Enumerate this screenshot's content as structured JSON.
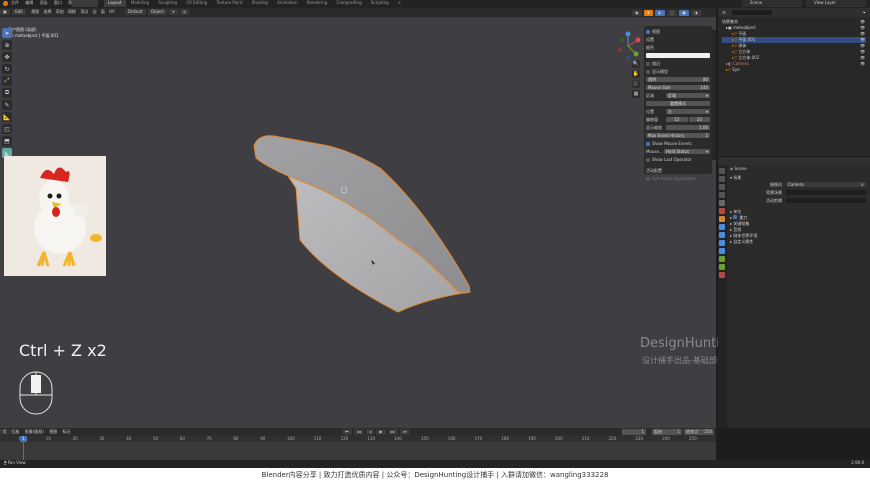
{
  "app": {
    "menu": [
      "文件",
      "编辑",
      "渲染",
      "窗口",
      "帮助"
    ],
    "workspace_tabs": [
      "Layout",
      "Modeling",
      "Sculpting",
      "UV Editing",
      "Texture Paint",
      "Shading",
      "Animation",
      "Rendering",
      "Compositing",
      "Scripting"
    ],
    "active_tab": "Layout",
    "scene_label": "Scene",
    "view_layer_label": "View Layer"
  },
  "viewport": {
    "mode": "Edit",
    "view_menu": [
      "视图",
      "选择",
      "添加",
      "网格",
      "顶点",
      "边",
      "面",
      "UV"
    ],
    "orientation": "Default",
    "pivot": "Object",
    "info_line1": "用户透视 (局部)",
    "info_line2": "(0) metaobject | 平面.001"
  },
  "overlay": {
    "shortcut": "Ctrl + Z x2",
    "watermark_title": "DesignHunting",
    "watermark_sub": "设计捕手出品-基础部分"
  },
  "npanel": {
    "header": "视图",
    "section1": "设置",
    "color_label": "颜色",
    "cb1": "描边",
    "cb2": "显示模型",
    "row_value1_label": "透明",
    "row_value1": "80",
    "mouse_size_label": "Mouse Size",
    "mouse_size": "144",
    "region_label": "区域",
    "region_value": "区域",
    "reset_btn": "重置模式",
    "pos_label": "位置",
    "pos_value": "左",
    "offset_label": "偏移量",
    "offset_x": "12",
    "offset_y": "33",
    "scale_label": "显示缩放",
    "scale_value": "1.00",
    "max_history_label": "Max Event History",
    "max_history": "2",
    "show_mouse": "Show Mouse Events",
    "mouse_mode_label": "Mouse...",
    "mouse_mode": "Hold Status",
    "show_last": "Show Last Operator",
    "adv_label": "活动配置",
    "adv_cb": "Get Active Application"
  },
  "outliner": {
    "title": "场景集合",
    "items": [
      "metaobject",
      "平面",
      "平面.001",
      "球体",
      "立方体",
      "立方体.002",
      "Camera",
      "Eye"
    ]
  },
  "properties": {
    "scene_title": "Scene",
    "section_scene": "场景",
    "camera_label": "摄像机",
    "camera_value": "Camera",
    "bg_scene_label": "背景场景",
    "active_clip_label": "活动剪辑",
    "section_units": "单位",
    "gravity_label": "重力",
    "section_keying": "关键帧集",
    "section_audio": "音频",
    "section_rigid": "刚体世界环境",
    "section_custom": "自定义属性"
  },
  "timeline": {
    "menu": [
      "回放",
      "抠像(插帧)",
      "视图",
      "标记"
    ],
    "current_frame": "1",
    "start_label": "起始",
    "start": "1",
    "end_label": "结束点",
    "end": "250",
    "ticks": [
      "0",
      "10",
      "20",
      "30",
      "40",
      "50",
      "60",
      "70",
      "80",
      "90",
      "100",
      "110",
      "120",
      "130",
      "140",
      "150",
      "160",
      "170",
      "180",
      "190",
      "200",
      "210",
      "220",
      "230",
      "240",
      "250"
    ]
  },
  "status": {
    "left": "Pan View",
    "right": "2.90.0"
  },
  "footer": {
    "text": "Blender内容分享  |  致力打造优质内容  |  公众号：DesignHunting设计捕手  |  入群请加微信：wangling333228"
  }
}
